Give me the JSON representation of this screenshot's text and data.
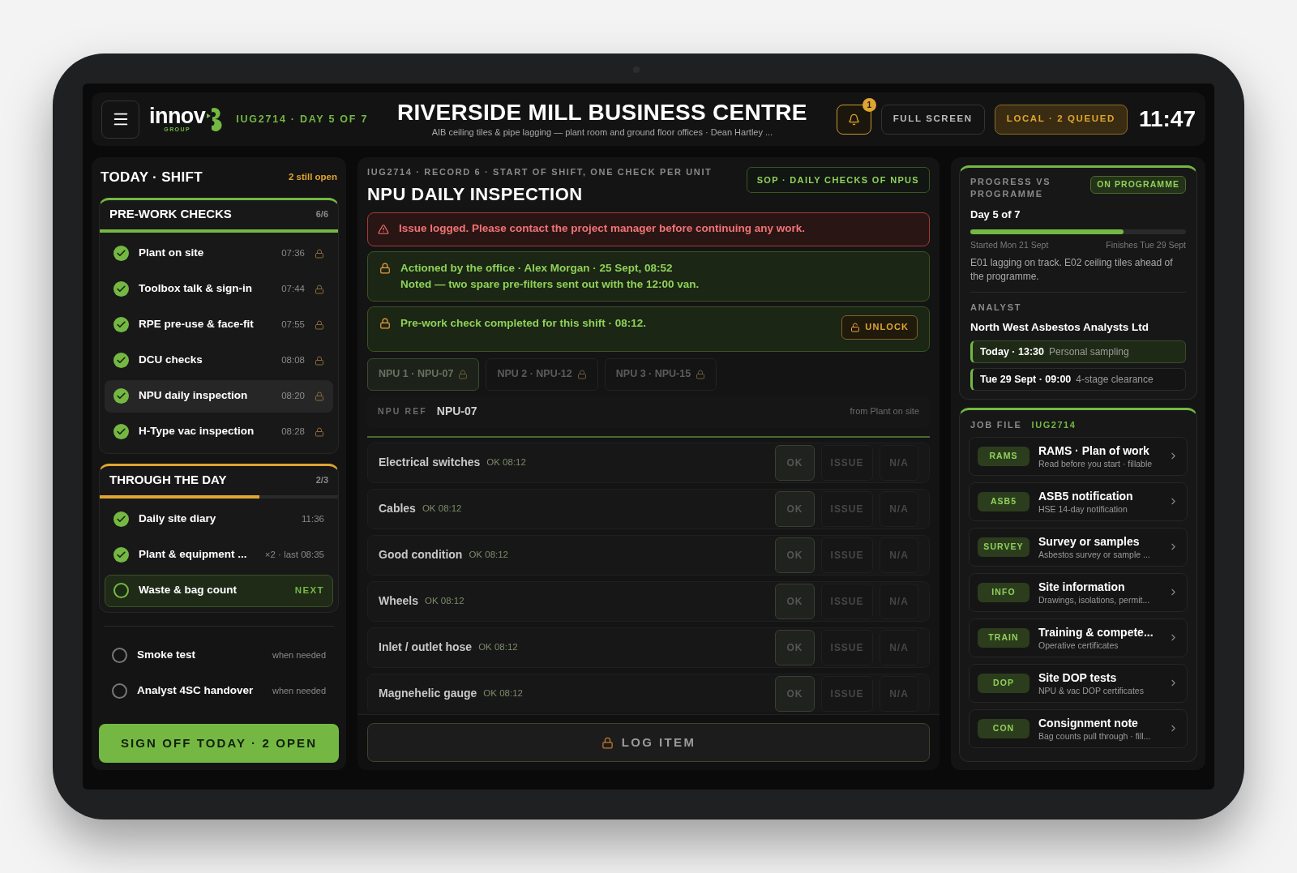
{
  "header": {
    "logo": {
      "wordmark": "innov",
      "sub": "GROUP"
    },
    "job_line": "IUG2714 · DAY 5 OF 7",
    "title": "RIVERSIDE MILL BUSINESS CENTRE",
    "subtitle": "AIB ceiling tiles & pipe lagging — plant room and ground floor offices · Dean Hartley ...",
    "notifications": "1",
    "fullscreen": "FULL SCREEN",
    "sync": "LOCAL · 2 QUEUED",
    "time": "11:47"
  },
  "shift": {
    "title": "TODAY · SHIFT",
    "open_note": "2 still open",
    "groups": [
      {
        "title": "PRE-WORK CHECKS",
        "count": "6/6",
        "color": "#74b843",
        "level": 1,
        "items": [
          {
            "kind": "done",
            "label": "Plant on site",
            "meta": "07:36",
            "locked": true,
            "selected": false
          },
          {
            "kind": "done",
            "label": "Toolbox talk & sign-in",
            "meta": "07:44",
            "locked": true,
            "selected": false
          },
          {
            "kind": "done",
            "label": "RPE pre-use & face-fit",
            "meta": "07:55",
            "locked": true,
            "selected": false
          },
          {
            "kind": "done",
            "label": "DCU checks",
            "meta": "08:08",
            "locked": true,
            "selected": false
          },
          {
            "kind": "done",
            "label": "NPU daily inspection",
            "meta": "08:20",
            "locked": true,
            "selected": true
          },
          {
            "kind": "done",
            "label": "H-Type vac inspection",
            "meta": "08:28",
            "locked": true,
            "selected": false
          }
        ]
      },
      {
        "title": "THROUGH THE DAY",
        "count": "2/3",
        "color": "#e0a530",
        "level": 0.67,
        "items": [
          {
            "kind": "done",
            "label": "Daily site diary",
            "meta": "11:36",
            "locked": false,
            "selected": false
          },
          {
            "kind": "done",
            "label": "Plant & equipment ...",
            "meta": "×2 · last 08:35",
            "locked": false,
            "selected": false
          },
          {
            "kind": "next",
            "label": "Waste & bag count",
            "meta": "NEXT",
            "locked": false,
            "selected": false
          }
        ]
      }
    ],
    "optional": [
      {
        "label": "Smoke test",
        "meta": "when needed"
      },
      {
        "label": "Analyst 4SC handover",
        "meta": "when needed"
      }
    ],
    "sign_off": "SIGN OFF TODAY · 2 OPEN"
  },
  "record": {
    "record_line": "IUG2714 · RECORD 6 · START OF SHIFT, ONE CHECK PER UNIT",
    "title": "NPU DAILY INSPECTION",
    "sop": "SOP · DAILY CHECKS OF NPUS",
    "alerts": [
      {
        "kind": "error",
        "lines": [
          "Issue logged. Please contact the project manager before continuing any work."
        ]
      },
      {
        "kind": "note",
        "lines": [
          "Actioned by the office · Alex Morgan · 25 Sept, 08:52",
          "Noted — two spare pre-filters sent out with the 12:00 van."
        ]
      },
      {
        "kind": "locked",
        "lines": [
          "Pre-work check completed for this shift · 08:12."
        ],
        "button": "UNLOCK"
      }
    ],
    "units": [
      {
        "label": "NPU 1 · NPU-07",
        "selected": true
      },
      {
        "label": "NPU 2 · NPU-12",
        "selected": false
      },
      {
        "label": "NPU 3 · NPU-15",
        "selected": false
      }
    ],
    "npu_ref": {
      "label": "NPU REF",
      "value": "NPU-07",
      "source": "from Plant on site"
    },
    "checks": [
      {
        "label": "Electrical switches",
        "status": "OK 08:12",
        "options": [
          {
            "label": "OK",
            "selected": true
          },
          {
            "label": "ISSUE",
            "selected": false
          },
          {
            "label": "N/A",
            "selected": false
          }
        ]
      },
      {
        "label": "Cables",
        "status": "OK 08:12",
        "options": [
          {
            "label": "OK",
            "selected": true
          },
          {
            "label": "ISSUE",
            "selected": false
          },
          {
            "label": "N/A",
            "selected": false
          }
        ]
      },
      {
        "label": "Good condition",
        "status": "OK 08:12",
        "options": [
          {
            "label": "OK",
            "selected": true
          },
          {
            "label": "ISSUE",
            "selected": false
          },
          {
            "label": "N/A",
            "selected": false
          }
        ]
      },
      {
        "label": "Wheels",
        "status": "OK 08:12",
        "options": [
          {
            "label": "OK",
            "selected": true
          },
          {
            "label": "ISSUE",
            "selected": false
          },
          {
            "label": "N/A",
            "selected": false
          }
        ]
      },
      {
        "label": "Inlet / outlet hose",
        "status": "OK 08:12",
        "options": [
          {
            "label": "OK",
            "selected": true
          },
          {
            "label": "ISSUE",
            "selected": false
          },
          {
            "label": "N/A",
            "selected": false
          }
        ]
      },
      {
        "label": "Magnehelic gauge",
        "status": "OK 08:12",
        "options": [
          {
            "label": "OK",
            "selected": true
          },
          {
            "label": "ISSUE",
            "selected": false
          },
          {
            "label": "N/A",
            "selected": false
          }
        ]
      }
    ],
    "log_button": "LOG ITEM"
  },
  "progress": {
    "title": "PROGRESS VS PROGRAMME",
    "status": "ON PROGRAMME",
    "day": "Day 5 of 7",
    "level": 0.71,
    "started": "Started Mon 21 Sept",
    "finishes": "Finishes Tue 29 Sept",
    "note": "E01 lagging on track. E02 ceiling tiles ahead of the programme.",
    "analyst": {
      "label": "ANALYST",
      "name": "North West Asbestos Analysts Ltd",
      "visits": [
        {
          "when": "Today · 13:30",
          "what": "Personal sampling",
          "selected": true
        },
        {
          "when": "Tue 29 Sept · 09:00",
          "what": "4-stage clearance",
          "selected": false
        }
      ]
    }
  },
  "job_file": {
    "label": "JOB FILE",
    "ref": "IUG2714",
    "items": [
      {
        "tag": "RAMS",
        "title": "RAMS · Plan of work",
        "subtitle": "Read before you start · fillable"
      },
      {
        "tag": "ASB5",
        "title": "ASB5 notification",
        "subtitle": "HSE 14-day notification"
      },
      {
        "tag": "SURVEY",
        "title": "Survey or samples",
        "subtitle": "Asbestos survey or sample ..."
      },
      {
        "tag": "INFO",
        "title": "Site information",
        "subtitle": "Drawings, isolations, permit..."
      },
      {
        "tag": "TRAIN",
        "title": "Training & compete...",
        "subtitle": "Operative certificates"
      },
      {
        "tag": "DOP",
        "title": "Site DOP tests",
        "subtitle": "NPU & vac DOP certificates"
      },
      {
        "tag": "CON",
        "title": "Consignment note",
        "subtitle": "Bag counts pull through · fill..."
      }
    ]
  }
}
